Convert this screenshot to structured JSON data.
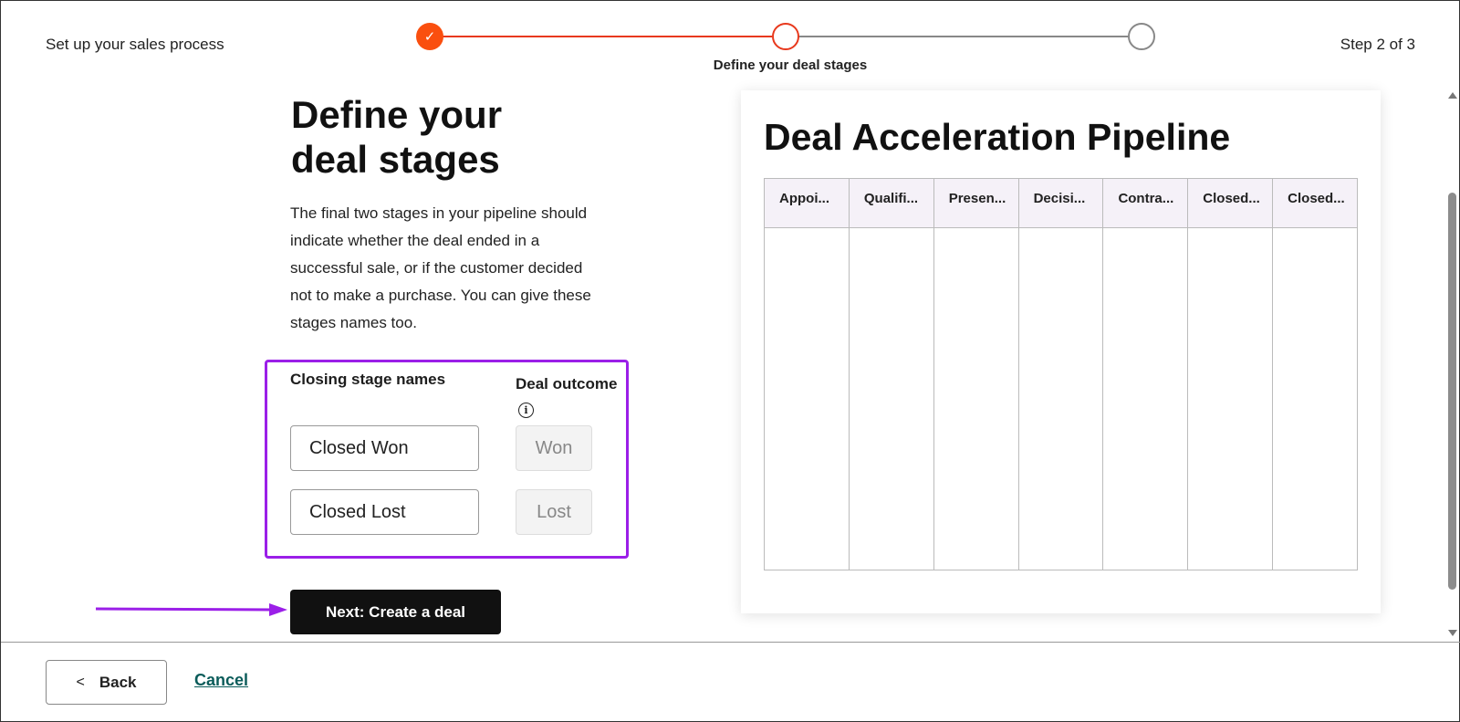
{
  "header": {
    "title": "Set up your sales process",
    "step_count": "Step 2 of 3",
    "current_step_label": "Define your deal stages"
  },
  "main": {
    "title": "Define your deal stages",
    "intro": "The final two stages in your pipeline should indicate whether the deal ended in a successful sale, or if the customer decided not to make a purchase. You can give these stages names too.",
    "closing_stage_names_label": "Closing stage names",
    "deal_outcome_label": "Deal outcome",
    "stages": [
      {
        "name": "Closed Won",
        "outcome": "Won"
      },
      {
        "name": "Closed Lost",
        "outcome": "Lost"
      }
    ],
    "next_button_label": "Next: Create a deal"
  },
  "preview": {
    "title": "Deal Acceleration Pipeline",
    "columns": [
      "Appoi...",
      "Qualifi...",
      "Presen...",
      "Decisi...",
      "Contra...",
      "Closed...",
      "Closed..."
    ]
  },
  "footer": {
    "back_label": "Back",
    "cancel_label": "Cancel"
  },
  "colors": {
    "accent": "#fa4f0f",
    "highlight": "#9b1fe8",
    "link": "#0b5c5a"
  }
}
